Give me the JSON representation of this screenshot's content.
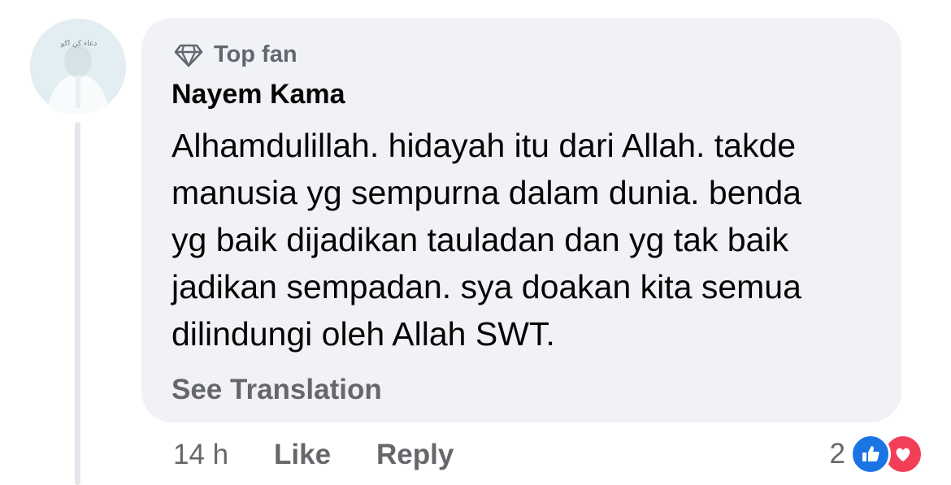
{
  "avatar": {
    "overlay_text": "دعاء كن اكو",
    "alt": "profile photo"
  },
  "comment": {
    "badge": {
      "icon": "diamond-icon",
      "label": "Top fan"
    },
    "author": "Nayem Kama",
    "text_lines": [
      "Alhamdulillah. hidayah itu dari Allah. takde",
      "manusia yg sempurna dalam dunia. benda",
      "yg baik dijadikan tauladan dan yg tak baik",
      "jadikan sempadan. sya doakan kita semua",
      "dilindungi oleh Allah SWT."
    ],
    "see_translation": "See Translation"
  },
  "meta": {
    "time": "14 h",
    "like_label": "Like",
    "reply_label": "Reply"
  },
  "reactions": {
    "count": "2",
    "types": [
      "like-icon",
      "love-icon"
    ]
  },
  "colors": {
    "bubble_bg": "#f0f2f5",
    "secondary_text": "#65676b",
    "primary_text": "#050505",
    "like_blue": "#1b74e4",
    "love_red": "#f33e58"
  }
}
